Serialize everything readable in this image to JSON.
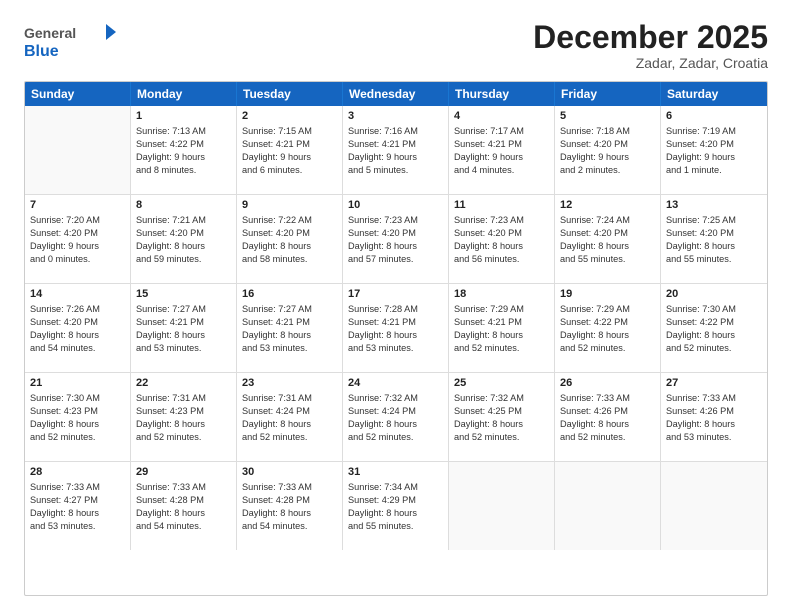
{
  "logo": {
    "general": "General",
    "blue": "Blue"
  },
  "header": {
    "month": "December 2025",
    "location": "Zadar, Zadar, Croatia"
  },
  "days_of_week": [
    "Sunday",
    "Monday",
    "Tuesday",
    "Wednesday",
    "Thursday",
    "Friday",
    "Saturday"
  ],
  "weeks": [
    [
      {
        "day": "",
        "lines": []
      },
      {
        "day": "1",
        "lines": [
          "Sunrise: 7:13 AM",
          "Sunset: 4:22 PM",
          "Daylight: 9 hours",
          "and 8 minutes."
        ]
      },
      {
        "day": "2",
        "lines": [
          "Sunrise: 7:15 AM",
          "Sunset: 4:21 PM",
          "Daylight: 9 hours",
          "and 6 minutes."
        ]
      },
      {
        "day": "3",
        "lines": [
          "Sunrise: 7:16 AM",
          "Sunset: 4:21 PM",
          "Daylight: 9 hours",
          "and 5 minutes."
        ]
      },
      {
        "day": "4",
        "lines": [
          "Sunrise: 7:17 AM",
          "Sunset: 4:21 PM",
          "Daylight: 9 hours",
          "and 4 minutes."
        ]
      },
      {
        "day": "5",
        "lines": [
          "Sunrise: 7:18 AM",
          "Sunset: 4:20 PM",
          "Daylight: 9 hours",
          "and 2 minutes."
        ]
      },
      {
        "day": "6",
        "lines": [
          "Sunrise: 7:19 AM",
          "Sunset: 4:20 PM",
          "Daylight: 9 hours",
          "and 1 minute."
        ]
      }
    ],
    [
      {
        "day": "7",
        "lines": [
          "Sunrise: 7:20 AM",
          "Sunset: 4:20 PM",
          "Daylight: 9 hours",
          "and 0 minutes."
        ]
      },
      {
        "day": "8",
        "lines": [
          "Sunrise: 7:21 AM",
          "Sunset: 4:20 PM",
          "Daylight: 8 hours",
          "and 59 minutes."
        ]
      },
      {
        "day": "9",
        "lines": [
          "Sunrise: 7:22 AM",
          "Sunset: 4:20 PM",
          "Daylight: 8 hours",
          "and 58 minutes."
        ]
      },
      {
        "day": "10",
        "lines": [
          "Sunrise: 7:23 AM",
          "Sunset: 4:20 PM",
          "Daylight: 8 hours",
          "and 57 minutes."
        ]
      },
      {
        "day": "11",
        "lines": [
          "Sunrise: 7:23 AM",
          "Sunset: 4:20 PM",
          "Daylight: 8 hours",
          "and 56 minutes."
        ]
      },
      {
        "day": "12",
        "lines": [
          "Sunrise: 7:24 AM",
          "Sunset: 4:20 PM",
          "Daylight: 8 hours",
          "and 55 minutes."
        ]
      },
      {
        "day": "13",
        "lines": [
          "Sunrise: 7:25 AM",
          "Sunset: 4:20 PM",
          "Daylight: 8 hours",
          "and 55 minutes."
        ]
      }
    ],
    [
      {
        "day": "14",
        "lines": [
          "Sunrise: 7:26 AM",
          "Sunset: 4:20 PM",
          "Daylight: 8 hours",
          "and 54 minutes."
        ]
      },
      {
        "day": "15",
        "lines": [
          "Sunrise: 7:27 AM",
          "Sunset: 4:21 PM",
          "Daylight: 8 hours",
          "and 53 minutes."
        ]
      },
      {
        "day": "16",
        "lines": [
          "Sunrise: 7:27 AM",
          "Sunset: 4:21 PM",
          "Daylight: 8 hours",
          "and 53 minutes."
        ]
      },
      {
        "day": "17",
        "lines": [
          "Sunrise: 7:28 AM",
          "Sunset: 4:21 PM",
          "Daylight: 8 hours",
          "and 53 minutes."
        ]
      },
      {
        "day": "18",
        "lines": [
          "Sunrise: 7:29 AM",
          "Sunset: 4:21 PM",
          "Daylight: 8 hours",
          "and 52 minutes."
        ]
      },
      {
        "day": "19",
        "lines": [
          "Sunrise: 7:29 AM",
          "Sunset: 4:22 PM",
          "Daylight: 8 hours",
          "and 52 minutes."
        ]
      },
      {
        "day": "20",
        "lines": [
          "Sunrise: 7:30 AM",
          "Sunset: 4:22 PM",
          "Daylight: 8 hours",
          "and 52 minutes."
        ]
      }
    ],
    [
      {
        "day": "21",
        "lines": [
          "Sunrise: 7:30 AM",
          "Sunset: 4:23 PM",
          "Daylight: 8 hours",
          "and 52 minutes."
        ]
      },
      {
        "day": "22",
        "lines": [
          "Sunrise: 7:31 AM",
          "Sunset: 4:23 PM",
          "Daylight: 8 hours",
          "and 52 minutes."
        ]
      },
      {
        "day": "23",
        "lines": [
          "Sunrise: 7:31 AM",
          "Sunset: 4:24 PM",
          "Daylight: 8 hours",
          "and 52 minutes."
        ]
      },
      {
        "day": "24",
        "lines": [
          "Sunrise: 7:32 AM",
          "Sunset: 4:24 PM",
          "Daylight: 8 hours",
          "and 52 minutes."
        ]
      },
      {
        "day": "25",
        "lines": [
          "Sunrise: 7:32 AM",
          "Sunset: 4:25 PM",
          "Daylight: 8 hours",
          "and 52 minutes."
        ]
      },
      {
        "day": "26",
        "lines": [
          "Sunrise: 7:33 AM",
          "Sunset: 4:26 PM",
          "Daylight: 8 hours",
          "and 52 minutes."
        ]
      },
      {
        "day": "27",
        "lines": [
          "Sunrise: 7:33 AM",
          "Sunset: 4:26 PM",
          "Daylight: 8 hours",
          "and 53 minutes."
        ]
      }
    ],
    [
      {
        "day": "28",
        "lines": [
          "Sunrise: 7:33 AM",
          "Sunset: 4:27 PM",
          "Daylight: 8 hours",
          "and 53 minutes."
        ]
      },
      {
        "day": "29",
        "lines": [
          "Sunrise: 7:33 AM",
          "Sunset: 4:28 PM",
          "Daylight: 8 hours",
          "and 54 minutes."
        ]
      },
      {
        "day": "30",
        "lines": [
          "Sunrise: 7:33 AM",
          "Sunset: 4:28 PM",
          "Daylight: 8 hours",
          "and 54 minutes."
        ]
      },
      {
        "day": "31",
        "lines": [
          "Sunrise: 7:34 AM",
          "Sunset: 4:29 PM",
          "Daylight: 8 hours",
          "and 55 minutes."
        ]
      },
      {
        "day": "",
        "lines": []
      },
      {
        "day": "",
        "lines": []
      },
      {
        "day": "",
        "lines": []
      }
    ]
  ]
}
